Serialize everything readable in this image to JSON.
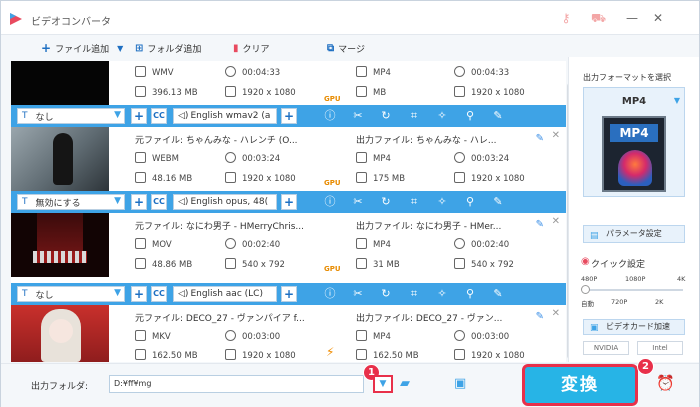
{
  "app": {
    "title": "ビデオコンバータ"
  },
  "toolbar": {
    "add_file": "ファイル追加",
    "add_folder": "フォルダ追加",
    "clear": "クリア",
    "merge": "マージ"
  },
  "items": [
    {
      "src_format": "WMV",
      "src_duration": "00:04:33",
      "src_size": "396.13 MB",
      "src_res": "1920 x 1080",
      "dst_format": "MP4",
      "dst_duration": "00:04:33",
      "dst_size": "MB",
      "dst_res": "1920 x 1080",
      "gpu": "GPU"
    },
    {
      "src_name": "元ファイル: ちゃんみな - ハレンチ (O...",
      "dst_name": "出力ファイル: ちゃんみな - ハレ...",
      "src_format": "WEBM",
      "src_duration": "00:03:24",
      "src_size": "48.16 MB",
      "src_res": "1920 x 1080",
      "dst_format": "MP4",
      "dst_duration": "00:03:24",
      "dst_size": "175 MB",
      "dst_res": "1920 x 1080",
      "gpu": "GPU"
    },
    {
      "src_name": "元ファイル: なにわ男子 - HMerryChris...",
      "dst_name": "出力ファイル: なにわ男子 - HMer...",
      "src_format": "MOV",
      "src_duration": "00:02:40",
      "src_size": "48.86 MB",
      "src_res": "540 x 792",
      "dst_format": "MP4",
      "dst_duration": "00:02:40",
      "dst_size": "31 MB",
      "dst_res": "540 x 792",
      "gpu": "GPU"
    },
    {
      "src_name": "元ファイル: DECO_27 - ヴァンパイア f...",
      "dst_name": "出力ファイル: DECO_27 - ヴァン...",
      "src_format": "MKV",
      "src_duration": "00:03:00",
      "src_size": "162.50 MB",
      "src_res": "1920 x 1080",
      "dst_format": "MP4",
      "dst_duration": "00:03:00",
      "dst_size": "162.50 MB",
      "dst_res": "1920 x 1080"
    }
  ],
  "bars": [
    {
      "subtitle": "なし",
      "audio": "English wmav2 (a"
    },
    {
      "subtitle": "無効にする",
      "audio": "English opus, 48("
    },
    {
      "subtitle": "なし",
      "audio": "English aac (LC)"
    }
  ],
  "cc_label": "CC",
  "right": {
    "title": "出力フォーマットを選択",
    "format": "MP4",
    "format_icon_label": "MP4",
    "param": "パラメータ設定",
    "quick": "クイック設定",
    "slider_top": [
      "480P",
      "1080P",
      "4K"
    ],
    "slider_bottom": [
      "自動",
      "720P",
      "2K"
    ],
    "accel": "ビデオカード加速",
    "brands": [
      "NVIDIA",
      "Intel"
    ]
  },
  "bottom": {
    "output_label": "出力フォルダ:",
    "output_path": "D:¥ff¥mg",
    "convert": "変換",
    "badge1": "1",
    "badge2": "2"
  }
}
